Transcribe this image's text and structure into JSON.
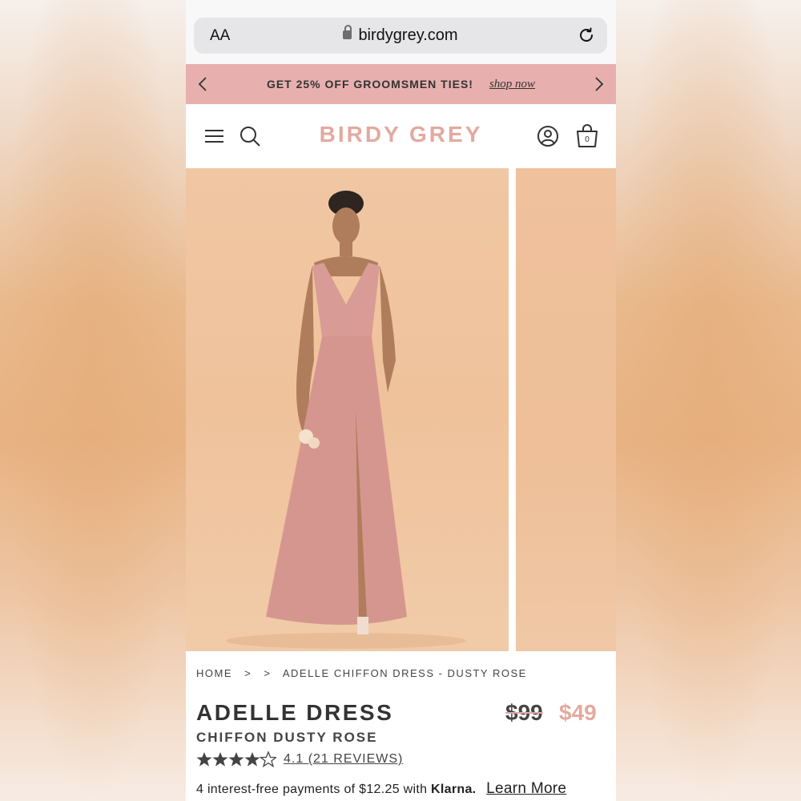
{
  "browser": {
    "text_size_label": "AA",
    "url": "birdygrey.com"
  },
  "promo": {
    "text": "GET 25% OFF GROOMSMEN TIES!",
    "link": "shop now"
  },
  "header": {
    "logo": "BIRDY GREY",
    "cart_count": "0"
  },
  "breadcrumb": {
    "home": "HOME",
    "sep1": ">",
    "sep2": ">",
    "current": "ADELLE CHIFFON DRESS - DUSTY ROSE"
  },
  "product": {
    "title": "ADELLE DRESS",
    "subtitle": "CHIFFON DUSTY ROSE",
    "price_original": "$99",
    "price_sale": "$49",
    "rating_value": 4.1,
    "rating_text": "4.1 (21 REVIEWS)",
    "installments_text": "4 interest-free payments of $12.25 with",
    "klarna_brand": "Klarna.",
    "learn_more": "Learn More"
  },
  "colors": {
    "brand_pink": "#e3a9a0",
    "promo_bg": "#e7b0ae",
    "photo_bg": "#f0c7a3",
    "dress": "#d99b96"
  }
}
